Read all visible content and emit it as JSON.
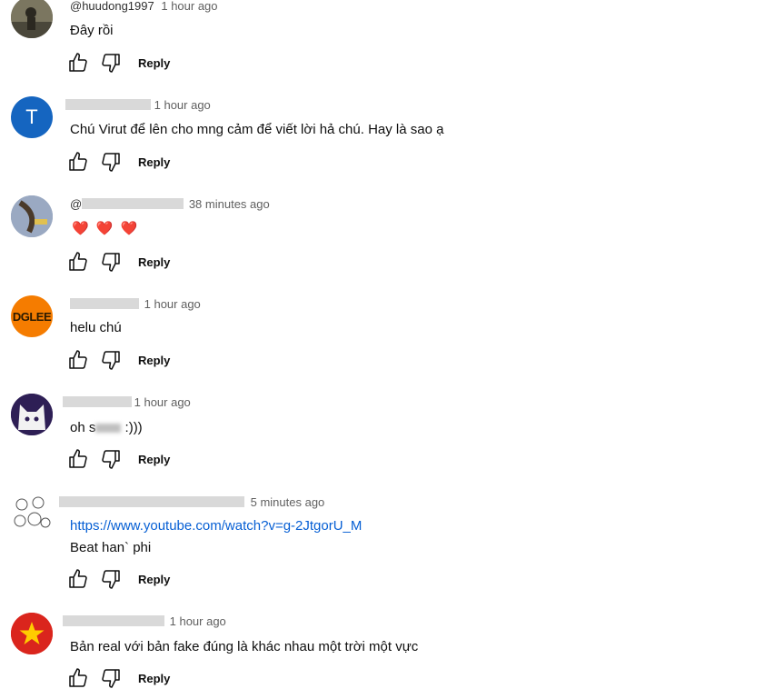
{
  "comments": [
    {
      "handle": "@huudong1997",
      "time": "1 hour ago",
      "text": "Đây rồi",
      "reply": "Reply",
      "avatar_color": "#6d6a55"
    },
    {
      "handle": "",
      "time": "1 hour ago",
      "text": "Chú Virut để lên cho mng cảm để viết lời hả chú. Hay là sao ạ",
      "reply": "Reply",
      "avatar_letter": "T",
      "avatar_color": "#1565c0"
    },
    {
      "handle": "@",
      "time": "38 minutes ago",
      "text": "❤️ ❤️ ❤️",
      "reply": "Reply",
      "avatar_color": "#8a9bb5"
    },
    {
      "handle": "",
      "time": "1 hour ago",
      "text": "helu chú",
      "reply": "Reply",
      "avatar_text": "DGLEE",
      "avatar_color": "#f57c00"
    },
    {
      "handle": "",
      "time": "1 hour ago",
      "text_before": "oh s",
      "text_after": " :)))",
      "reply": "Reply",
      "avatar_color": "#3c2a6b"
    },
    {
      "handle": "",
      "time": "5 minutes ago",
      "link": "https://www.youtube.com/watch?v=g-2JtgorU_M",
      "text": "Beat han` phi",
      "reply": "Reply",
      "avatar_color": "#ffffff"
    },
    {
      "handle": "",
      "time": "1 hour ago",
      "text": "Bản real với bản fake đúng là khác nhau một trời một vực",
      "reply": "Reply",
      "avatar_color": "#da251d",
      "avatar_star_color": "#ffcd00"
    }
  ]
}
